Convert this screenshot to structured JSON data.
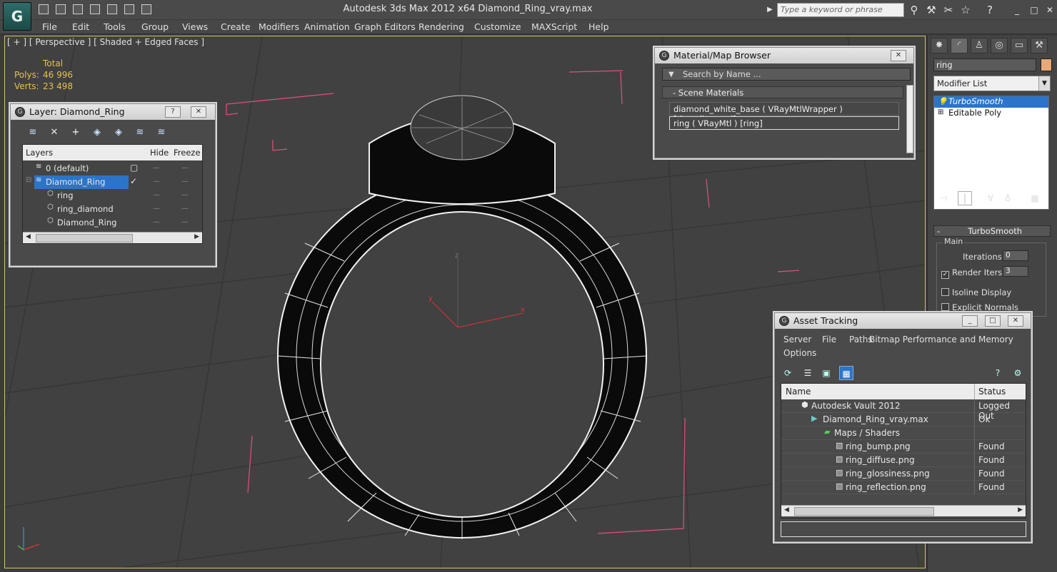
{
  "window": {
    "title": "Autodesk 3ds Max  2012 x64      Diamond_Ring_vray.max",
    "search_placeholder": "Type a keyword or phrase"
  },
  "menu": [
    "File",
    "Edit",
    "Tools",
    "Group",
    "Views",
    "Create",
    "Modifiers",
    "Animation",
    "Graph Editors",
    "Rendering",
    "Customize",
    "MAXScript",
    "Help"
  ],
  "viewport": {
    "label": "[ + ] [ Perspective ] [ Shaded + Edged Faces ]",
    "stats_header": "Total",
    "polys_label": "Polys:",
    "polys_value": "46 996",
    "verts_label": "Verts:",
    "verts_value": "23 498",
    "axis_x": "x",
    "axis_y": "y",
    "axis_z": "z"
  },
  "layer_dialog": {
    "title": "Layer: Diamond_Ring",
    "help": "?",
    "close": "✕",
    "headers": {
      "layers": "Layers",
      "hide": "Hide",
      "freeze": "Freeze"
    },
    "rows": [
      {
        "name": "0 (default)"
      },
      {
        "name": "Diamond_Ring"
      },
      {
        "name": "ring"
      },
      {
        "name": "ring_diamond"
      },
      {
        "name": "Diamond_Ring"
      }
    ]
  },
  "material_browser": {
    "title": "Material/Map Browser",
    "close": "✕",
    "search_placeholder": "Search by Name ...",
    "group": "- Scene Materials",
    "items": [
      "diamond_white_base  ( VRayMtlWrapper ) [ring_diamond]",
      "ring  ( VRayMtl ) [ring]"
    ]
  },
  "command_panel": {
    "object_name": "ring",
    "object_color": "#e8a878",
    "modifier_list": "Modifier List",
    "stack": [
      "TurboSmooth",
      "Editable Poly"
    ],
    "rollout_title": "TurboSmooth",
    "group_main": "Main",
    "iterations_label": "Iterations:",
    "iterations_value": "0",
    "render_iters_label": "Render Iters:",
    "render_iters_value": "3",
    "isoline": "Isoline Display",
    "explicit_normals": "Explicit Normals"
  },
  "asset_tracking": {
    "title": "Asset Tracking",
    "menu": [
      "Server",
      "File",
      "Paths",
      "Bitmap Performance and Memory",
      "Options"
    ],
    "headers": {
      "name": "Name",
      "status": "Status"
    },
    "rows": [
      {
        "name": "Autodesk Vault 2012",
        "status": "Logged Out"
      },
      {
        "name": "Diamond_Ring_vray.max",
        "status": "Ok"
      },
      {
        "name": "Maps / Shaders",
        "status": ""
      },
      {
        "name": "ring_bump.png",
        "status": "Found"
      },
      {
        "name": "ring_diffuse.png",
        "status": "Found"
      },
      {
        "name": "ring_glossiness.png",
        "status": "Found"
      },
      {
        "name": "ring_reflection.png",
        "status": "Found"
      }
    ]
  },
  "colors": {
    "selection": "#2c74c8",
    "stats": "#e6c04a",
    "bounding_box": "#e0507a"
  }
}
